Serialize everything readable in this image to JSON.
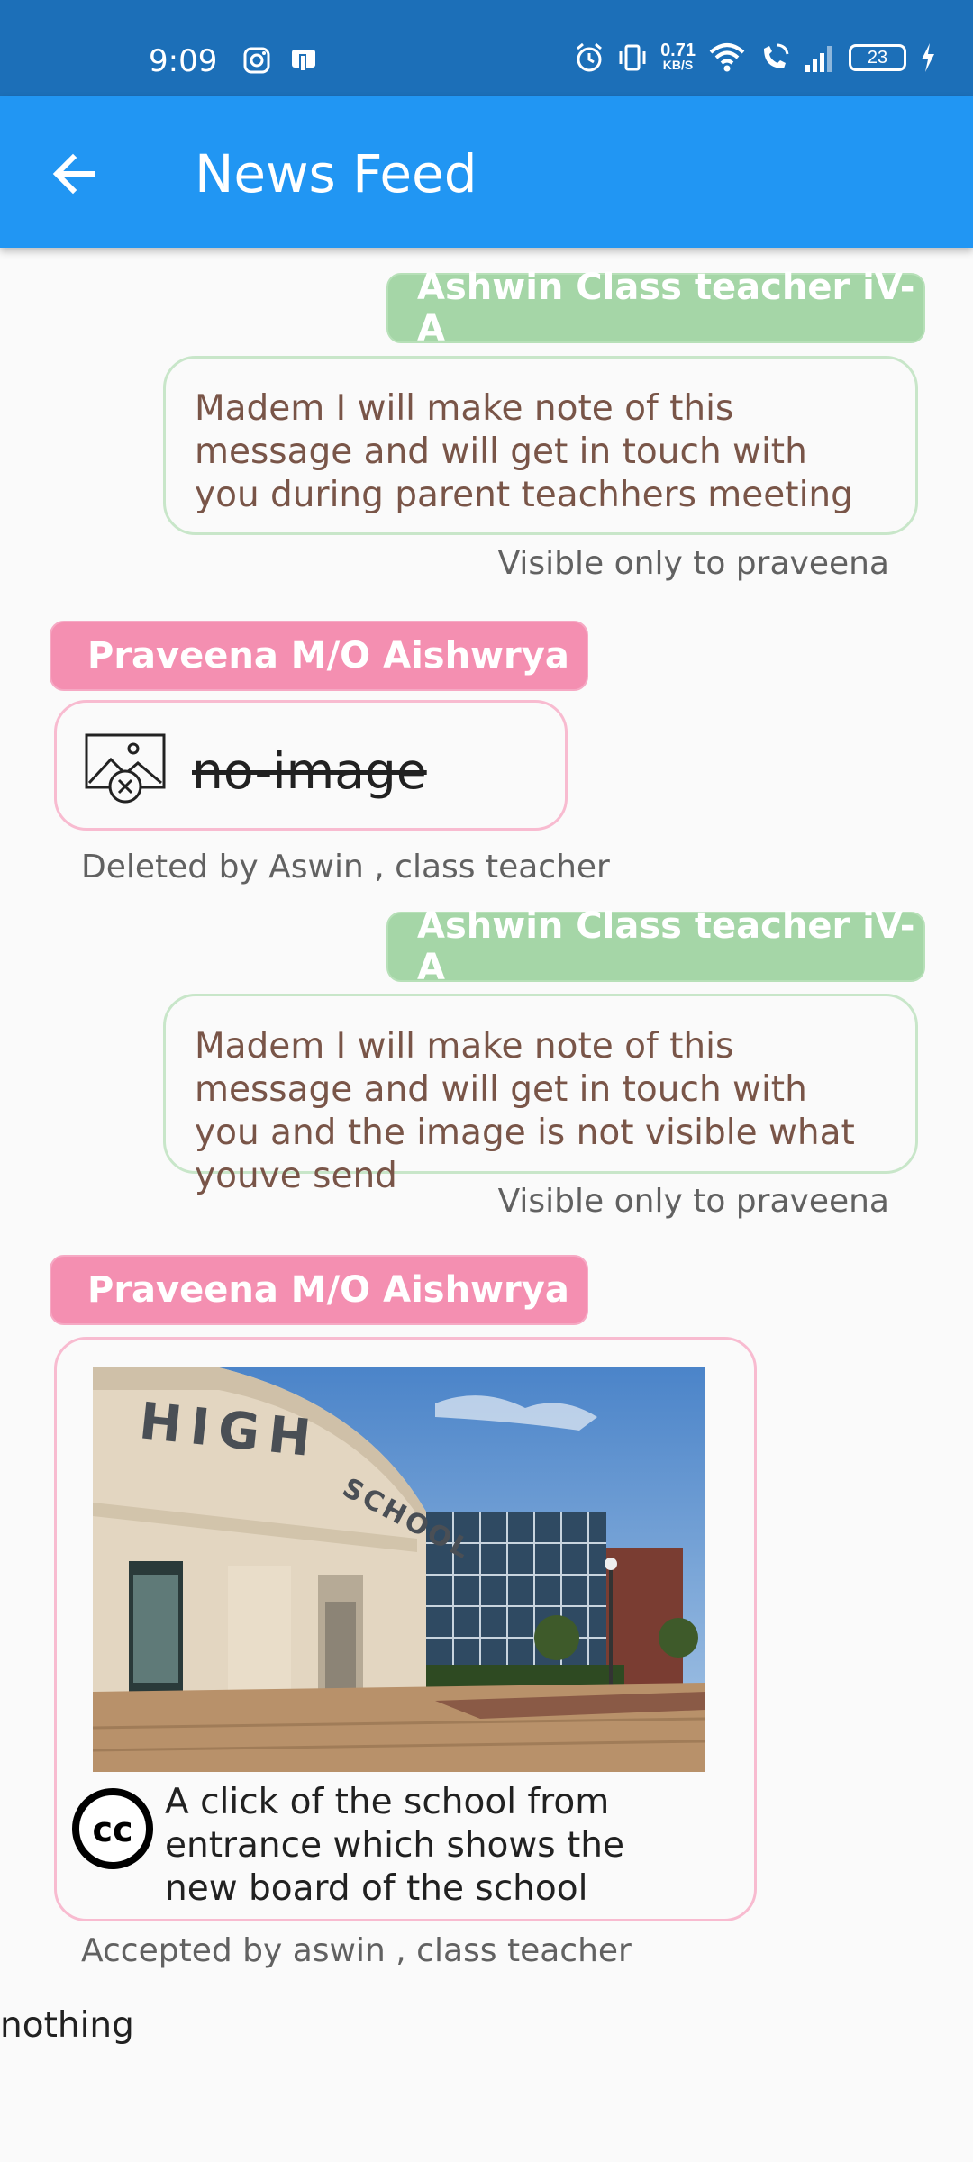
{
  "status": {
    "time": "9:09",
    "net_speed_value": "0.71",
    "net_speed_unit": "KB/S",
    "battery": "23"
  },
  "appbar": {
    "title": "News Feed"
  },
  "messages": [
    {
      "sender": "Ashwin Class teacher iV-A",
      "text": " Madem I will make note of this message and will get in touch with you during parent teachhers meeting",
      "meta": "Visible only to praveena"
    },
    {
      "sender": "Praveena M/O Aishwrya",
      "text": "no-image",
      "meta": "Deleted by Aswin , class teacher"
    },
    {
      "sender": "Ashwin Class teacher iV-A",
      "text": " Madem I will make note of this message and will get in touch with you and the image is not visible what youve send",
      "meta": "Visible only to praveena"
    },
    {
      "sender": "Praveena M/O Aishwrya",
      "image_sign_top": "HIGH",
      "image_sign_bottom": "SCHOOL",
      "caption": "A click of the school from entrance which shows the new board of the school",
      "meta": "Accepted by aswin , class teacher"
    }
  ],
  "footer_text": "nothing",
  "colors": {
    "status_bar": "#1c6fb8",
    "app_bar": "#2196f3",
    "teacher_tag": "#a5d6a7",
    "parent_tag": "#f48fb1",
    "message_text": "#795548"
  }
}
